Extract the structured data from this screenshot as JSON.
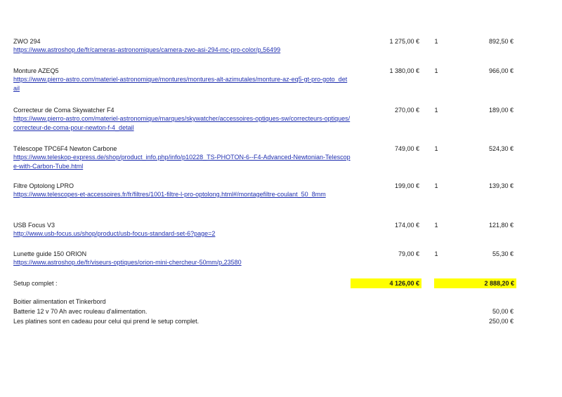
{
  "items": [
    {
      "name": "ZWO 294",
      "url": "https://www.astroshop.de/fr/cameras-astronomiques/camera-zwo-asi-294-mc-pro-color/p,56499",
      "price": "1 275,00 €",
      "qty": "1",
      "total": "892,50 €"
    },
    {
      "name": "Monture AZEQ5",
      "url": "https://www.pierro-astro.com/materiel-astronomique/montures/montures-alt-azimutales/monture-az-eq5-gt-pro-goto_detail",
      "price": "1 380,00 €",
      "qty": "1",
      "total": "966,00 €"
    },
    {
      "name": "Correcteur de Coma Skywatcher F4",
      "url": "https://www.pierro-astro.com/materiel-astronomique/marques/skywatcher/accessoires-optiques-sw/correcteurs-optiques/correcteur-de-coma-pour-newton-f-4_detail",
      "price": "270,00 €",
      "qty": "1",
      "total": "189,00 €"
    },
    {
      "name": "Télescope TPC6F4 Newton Carbone",
      "url": "https://www.teleskop-express.de/shop/product_info.php/info/p10228_TS-PHOTON-6--F4-Advanced-Newtonian-Telescope-with-Carbon-Tube.html",
      "price": "749,00 €",
      "qty": "1",
      "total": "524,30 €"
    },
    {
      "name": "Filtre Optolong LPRO",
      "url": "https://www.telescopes-et-accessoires.fr/fr/filtres/1001-filtre-l-pro-optolong.html#/montagefiltre-coulant_50_8mm",
      "price": "199,00 €",
      "qty": "1",
      "total": "139,30 €"
    },
    {
      "name": "USB Focus V3",
      "url": "http://www.usb-focus.us/shop/product/usb-focus-standard-set-6?page=2",
      "price": "174,00 €",
      "qty": "1",
      "total": "121,80 €"
    },
    {
      "name": "Lunette guide 150 ORION",
      "url": "https://www.astroshop.de/fr/viseurs-optiques/orion-mini-chercheur-50mm/p,23580",
      "price": "79,00 €",
      "qty": "1",
      "total": "55,30 €"
    }
  ],
  "summary": {
    "label": "Setup complet :",
    "price": "4 126,00 €",
    "total": "2 888,20 €"
  },
  "notes": [
    {
      "text": "Boitier alimentation et Tinkerbord",
      "amount": ""
    },
    {
      "text": "Batterie 12 v 70 Ah avec rouleau d'alimentation.",
      "amount": "50,00 €"
    },
    {
      "text": "Les platines sont en cadeau pour celui qui prend le setup complet.",
      "amount": "250,00 €"
    }
  ],
  "colors": {
    "link": "#1f2fb0",
    "highlight": "#ffff00"
  }
}
